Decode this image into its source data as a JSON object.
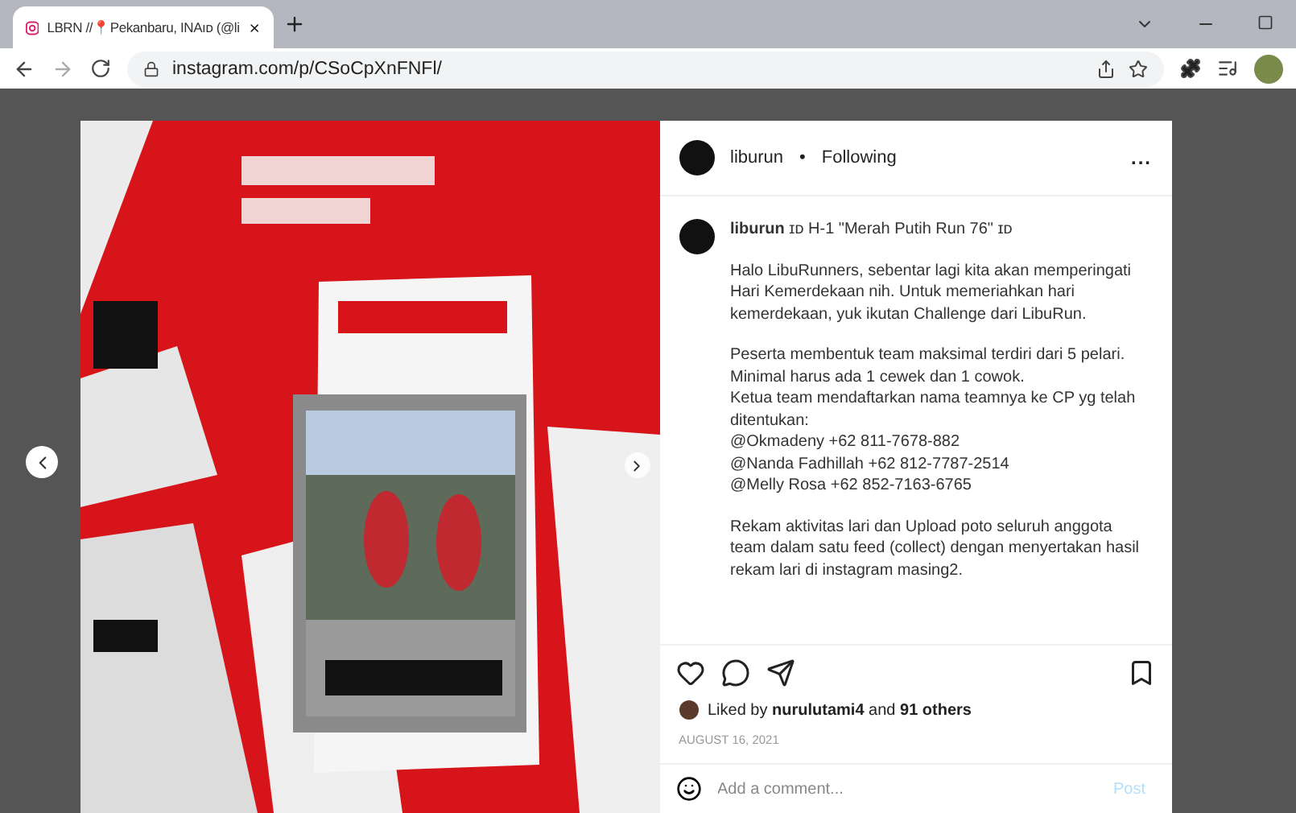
{
  "browser": {
    "tab": {
      "title": "LBRN //📍Pekanbaru, INAıᴅ (@li",
      "selected": true
    },
    "url": "instagram.com/p/CSoCpXnFNFl/"
  },
  "post": {
    "header": {
      "username": "liburun",
      "separator": "•",
      "status": "Following",
      "more": "..."
    },
    "caption": {
      "username": "liburun",
      "title": "ɪᴅ H-1 \"Merah Putih Run 76\" ɪᴅ",
      "paragraphs": [
        [
          "Halo LibuRunners, sebentar lagi kita akan memperingati Hari Kemerdekaan nih. Untuk memeriahkan hari kemerdekaan, yuk ikutan Challenge dari LibuRun."
        ],
        [
          "Peserta membentuk team maksimal terdiri dari 5 pelari. Minimal harus ada 1 cewek dan 1 cowok.",
          "Ketua team mendaftarkan nama teamnya ke CP yg telah ditentukan:",
          "@Okmadeny +62 811-7678-882",
          "@Nanda Fadhillah +62 812-7787-2514",
          "@Melly Rosa +62 852-7163-6765"
        ],
        [
          "Rekam aktivitas lari dan Upload poto seluruh anggota team dalam satu feed (collect) dengan menyertakan hasil rekam lari di instagram masing2."
        ]
      ]
    },
    "actions": {
      "liked": false,
      "saved": false
    },
    "likes": "Liked by **nurulutami4** and **91 others**",
    "date": "AUGUST 16, 2021",
    "comment": {
      "placeholder": "Add a comment...",
      "post_label": "Post"
    }
  }
}
